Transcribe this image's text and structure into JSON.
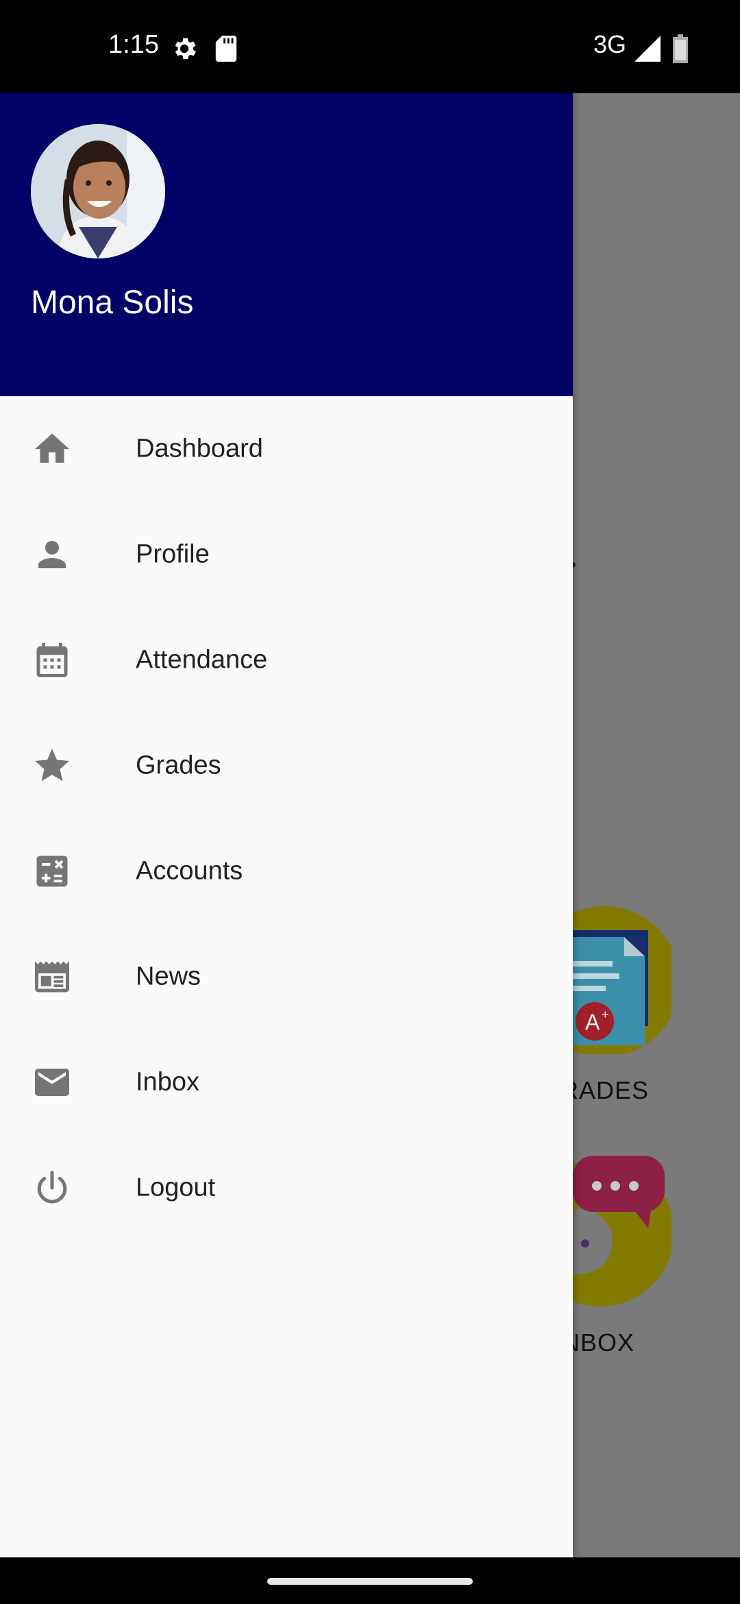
{
  "status_bar": {
    "time": "1:15",
    "network": "3G",
    "icons": [
      "settings-icon",
      "sd-card-icon",
      "signal-icon",
      "battery-icon"
    ]
  },
  "drawer": {
    "user_name": "Mona Solis",
    "header_color": "#000066",
    "menu": [
      {
        "label": "Dashboard",
        "icon": "home-icon"
      },
      {
        "label": "Profile",
        "icon": "person-icon"
      },
      {
        "label": "Attendance",
        "icon": "calendar-icon"
      },
      {
        "label": "Grades",
        "icon": "star-icon"
      },
      {
        "label": "Accounts",
        "icon": "calculator-icon"
      },
      {
        "label": "News",
        "icon": "news-icon"
      },
      {
        "label": "Inbox",
        "icon": "mail-icon"
      },
      {
        "label": "Logout",
        "icon": "power-icon"
      }
    ]
  },
  "background": {
    "tiles": [
      {
        "label": "RADES",
        "icon": "grades-document-icon"
      },
      {
        "label": "NBOX",
        "icon": "inbox-chat-icon"
      }
    ]
  }
}
